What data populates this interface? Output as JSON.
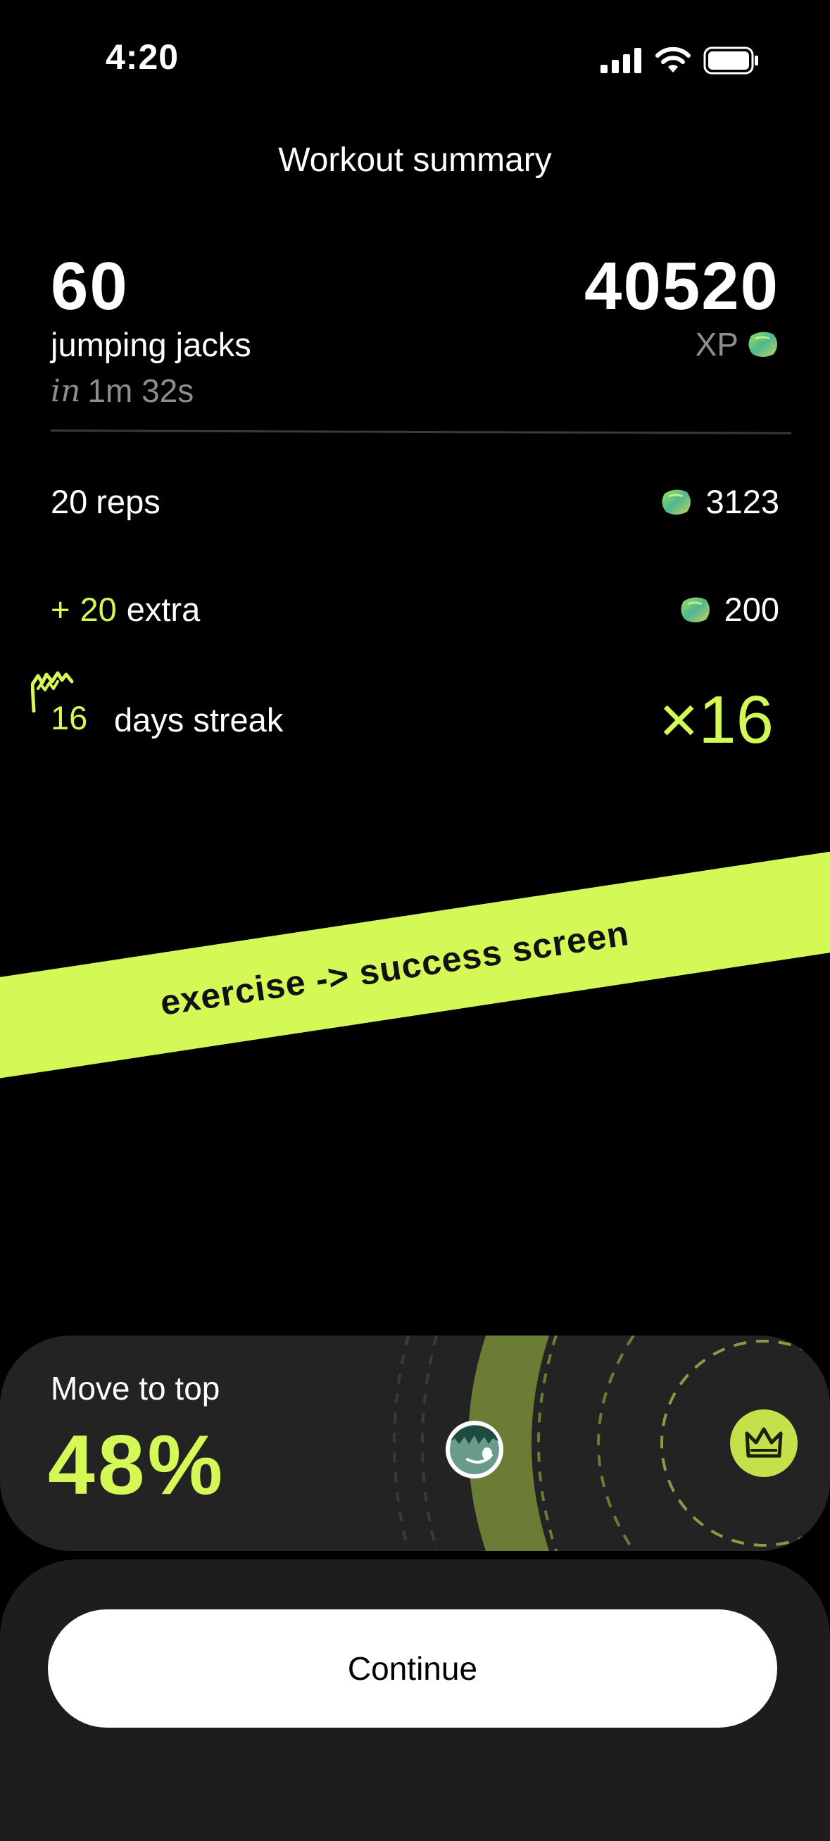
{
  "status_bar": {
    "time": "4:20",
    "icons": [
      "signal-icon",
      "wifi-icon",
      "battery-icon"
    ]
  },
  "header": {
    "title": "Workout summary"
  },
  "summary": {
    "count": "60",
    "exercise": "jumping jacks",
    "duration_prefix": "in",
    "duration": "1m 32s",
    "xp_total": "40520",
    "xp_label": "XP"
  },
  "rows": {
    "reps": {
      "value": "20",
      "label": "reps",
      "xp": "3123"
    },
    "extra": {
      "plus": "+",
      "value": "20",
      "label": "extra",
      "xp": "200"
    },
    "streak": {
      "value": "16",
      "label": "days streak",
      "multiplier": "×16"
    }
  },
  "banner": {
    "text": "exercise -> success screen"
  },
  "rank": {
    "label": "Move to top",
    "percent": "48%",
    "icons": [
      "avatar",
      "crown-icon"
    ]
  },
  "actions": {
    "continue_label": "Continue"
  },
  "colors": {
    "background": "#000000",
    "accent": "#d4f855",
    "muted": "#8e8e8e",
    "card": "#232323",
    "sheet": "#1d1d1d"
  }
}
